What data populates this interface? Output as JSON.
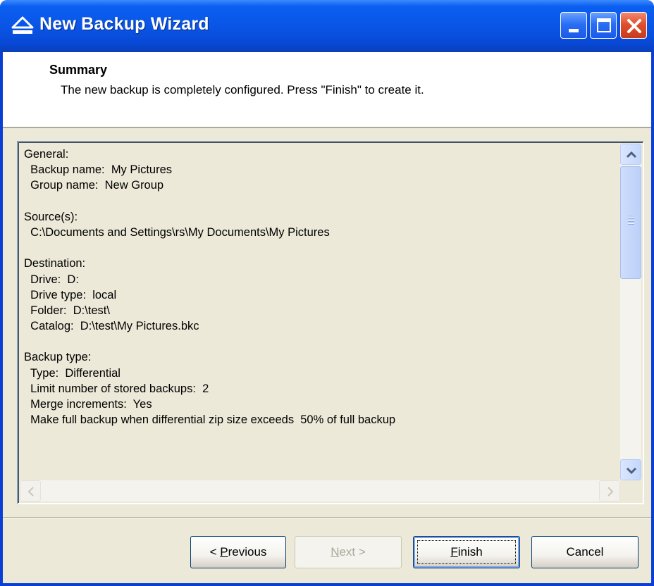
{
  "window": {
    "title": "New Backup Wizard",
    "icon": "backup-wizard-icon"
  },
  "header": {
    "title": "Summary",
    "description": "The new backup is completely configured. Press \"Finish\" to create it."
  },
  "summary": {
    "lines": [
      "General:",
      "  Backup name:  My Pictures",
      "  Group name:  New Group",
      "",
      "Source(s):",
      "  C:\\Documents and Settings\\rs\\My Documents\\My Pictures",
      "",
      "Destination:",
      "  Drive:  D:",
      "  Drive type:  local",
      "  Folder:  D:\\test\\",
      "  Catalog:  D:\\test\\My Pictures.bkc",
      "",
      "Backup type:",
      "  Type:  Differential",
      "  Limit number of stored backups:  2",
      "  Merge increments:  Yes",
      "  Make full backup when differential zip size exceeds  50% of full backup"
    ]
  },
  "buttons": {
    "previous": {
      "prefix": "< ",
      "mnemonic": "P",
      "rest": "revious"
    },
    "next": {
      "mnemonic": "N",
      "rest": "ext >"
    },
    "finish": {
      "mnemonic": "F",
      "rest": "inish"
    },
    "cancel": {
      "label": "Cancel"
    }
  },
  "colors": {
    "titlebar": "#0a55e6",
    "face": "#ece9d8",
    "close": "#e0502e"
  }
}
